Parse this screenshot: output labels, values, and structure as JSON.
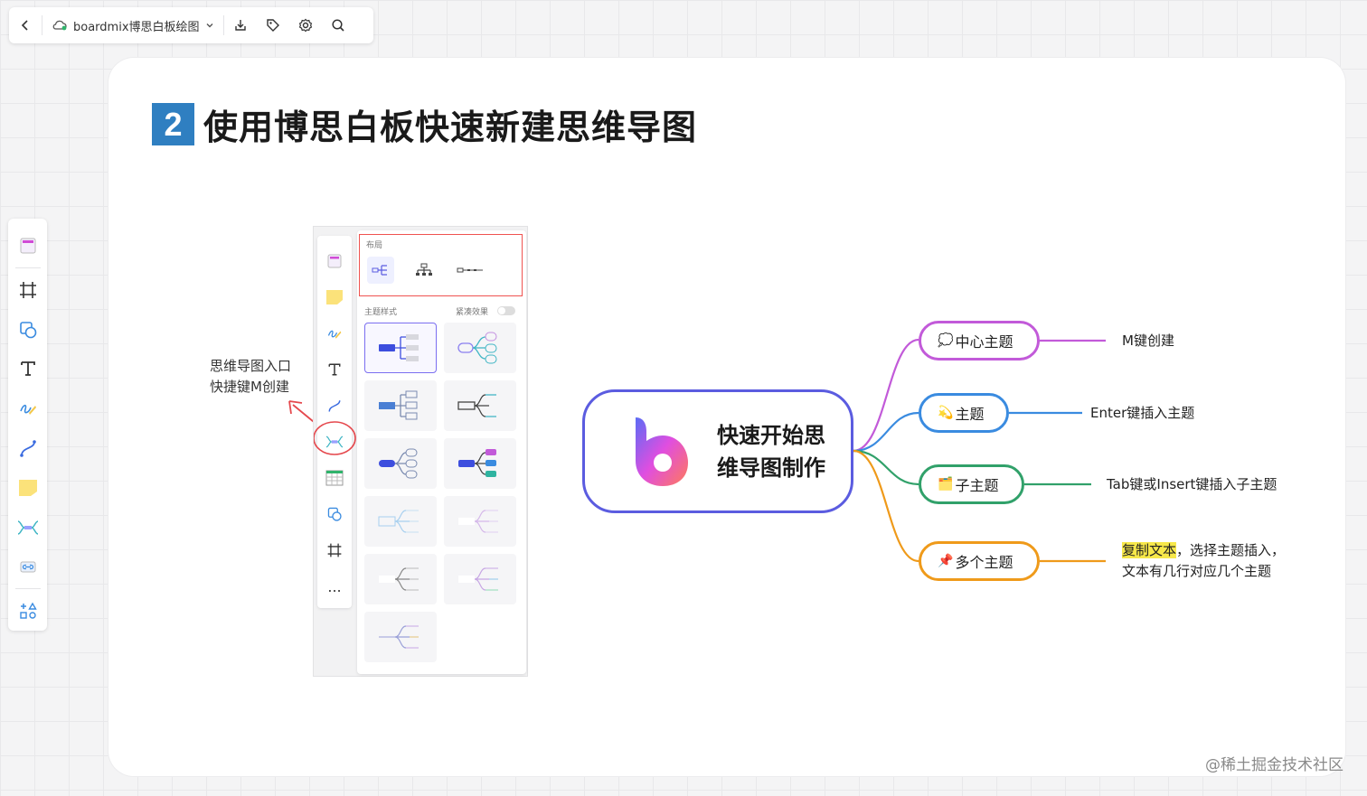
{
  "toolbar": {
    "title": "boardmix博思白板绘图",
    "icons": [
      "back-icon",
      "cloud-icon",
      "chevron-down-icon",
      "download-icon",
      "tag-icon",
      "settings-icon",
      "search-icon"
    ]
  },
  "rail": {
    "icons": [
      "template-icon",
      "frame-icon",
      "shape-icon",
      "text-icon",
      "pen-icon",
      "connector-icon",
      "sticky-note-icon",
      "mindmap-icon",
      "embed-icon",
      "more-tools-icon"
    ]
  },
  "heading": {
    "number": "2",
    "text": "使用博思白板快速新建思维导图"
  },
  "entry": {
    "line1": "思维导图入口",
    "line2": "快捷键M创建"
  },
  "panel": {
    "layout_label": "布局",
    "style_label": "主题样式",
    "compact_label": "紧凑效果",
    "more_label": "..."
  },
  "mindmap": {
    "center_line1": "快速开始思",
    "center_line2": "维导图制作",
    "branches": [
      {
        "emoji": "💭",
        "label": "中心主题",
        "note": "M键创建",
        "color": "#c25ad9"
      },
      {
        "emoji": "💫",
        "label": "主题",
        "note": "Enter键插入主题",
        "color": "#3a8be0"
      },
      {
        "emoji": "🗂️",
        "label": "子主题",
        "note": "Tab键或Insert键插入子主题",
        "color": "#31a16a"
      },
      {
        "emoji": "📌",
        "label": "多个主题",
        "note_highlight": "复制文本",
        "note_rest": "，选择主题插入，",
        "note_line2": "文本有几行对应几个主题",
        "color": "#ef9a1a"
      }
    ]
  },
  "watermark": "@稀土掘金技术社区",
  "colors": {
    "accent": "#5b5ce0",
    "heading_badge": "#2f7fc1",
    "annotation_red": "#e5484d"
  }
}
